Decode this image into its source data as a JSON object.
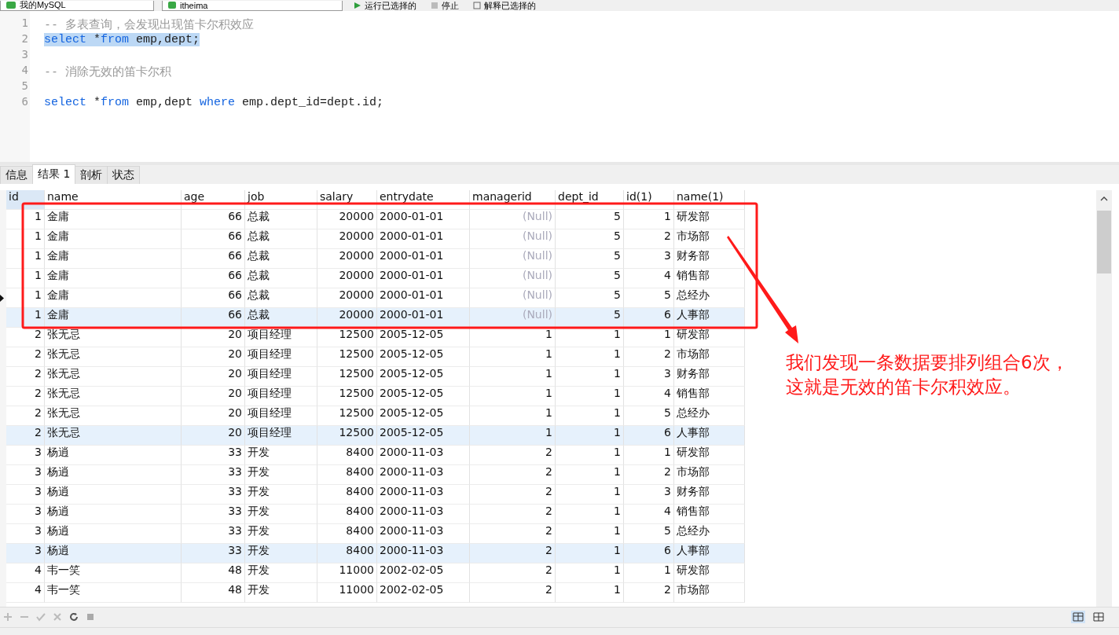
{
  "toolbar": {
    "items": [
      {
        "kind": "connection",
        "label": "我的MySQL"
      },
      {
        "kind": "database",
        "label": "itheima"
      },
      {
        "kind": "run",
        "label": "运行已选择的"
      },
      {
        "kind": "stop",
        "label": "停止"
      },
      {
        "kind": "explain",
        "label": "解释已选择的"
      }
    ]
  },
  "editor": {
    "lines": [
      {
        "number": "1",
        "selected": false,
        "tokens": [
          {
            "kind": "comment",
            "text": "-- 多表查询，会发现出现笛卡尔积效应"
          }
        ]
      },
      {
        "number": "2",
        "selected": true,
        "tokens": [
          {
            "kind": "keyword",
            "text": "select"
          },
          {
            "kind": "plain",
            "text": " *"
          },
          {
            "kind": "keyword",
            "text": "from"
          },
          {
            "kind": "plain",
            "text": " emp,dept;"
          }
        ]
      },
      {
        "number": "3",
        "selected": false
      },
      {
        "number": "4",
        "selected": false,
        "tokens": [
          {
            "kind": "comment",
            "text": "-- 消除无效的笛卡尔积"
          }
        ]
      },
      {
        "number": "5",
        "selected": false
      },
      {
        "number": "6",
        "selected": false,
        "tokens": [
          {
            "kind": "keyword",
            "text": "select"
          },
          {
            "kind": "plain",
            "text": " *"
          },
          {
            "kind": "keyword",
            "text": "from"
          },
          {
            "kind": "plain",
            "text": " emp,dept "
          },
          {
            "kind": "keyword",
            "text": "where"
          },
          {
            "kind": "plain",
            "text": " emp.dept_id=dept.id;"
          }
        ]
      }
    ]
  },
  "tabs": [
    {
      "label": "信息",
      "selected": false
    },
    {
      "label": "结果 1",
      "selected": true
    },
    {
      "label": "剖析",
      "selected": false
    },
    {
      "label": "状态",
      "selected": false
    }
  ],
  "table": {
    "columns": [
      "id",
      "name",
      "age",
      "job",
      "salary",
      "entrydate",
      "managerid",
      "dept_id",
      "id(1)",
      "name(1)"
    ],
    "rows": [
      {
        "cells": [
          "1",
          "金庸",
          "66",
          "总裁",
          "20000",
          "2000-01-01",
          "(Null)",
          "5",
          "1",
          "研发部"
        ],
        "managerid_null": true,
        "selected": false,
        "current": false
      },
      {
        "cells": [
          "1",
          "金庸",
          "66",
          "总裁",
          "20000",
          "2000-01-01",
          "(Null)",
          "5",
          "2",
          "市场部"
        ],
        "managerid_null": true,
        "selected": false,
        "current": false
      },
      {
        "cells": [
          "1",
          "金庸",
          "66",
          "总裁",
          "20000",
          "2000-01-01",
          "(Null)",
          "5",
          "3",
          "财务部"
        ],
        "managerid_null": true,
        "selected": false,
        "current": false
      },
      {
        "cells": [
          "1",
          "金庸",
          "66",
          "总裁",
          "20000",
          "2000-01-01",
          "(Null)",
          "5",
          "4",
          "销售部"
        ],
        "managerid_null": true,
        "selected": false,
        "current": false
      },
      {
        "cells": [
          "1",
          "金庸",
          "66",
          "总裁",
          "20000",
          "2000-01-01",
          "(Null)",
          "5",
          "5",
          "总经办"
        ],
        "managerid_null": true,
        "selected": false,
        "current": true
      },
      {
        "cells": [
          "1",
          "金庸",
          "66",
          "总裁",
          "20000",
          "2000-01-01",
          "(Null)",
          "5",
          "6",
          "人事部"
        ],
        "managerid_null": true,
        "selected": true,
        "current": false
      },
      {
        "cells": [
          "2",
          "张无忌",
          "20",
          "项目经理",
          "12500",
          "2005-12-05",
          "1",
          "1",
          "1",
          "研发部"
        ],
        "managerid_null": false,
        "selected": false,
        "current": false
      },
      {
        "cells": [
          "2",
          "张无忌",
          "20",
          "项目经理",
          "12500",
          "2005-12-05",
          "1",
          "1",
          "2",
          "市场部"
        ],
        "managerid_null": false,
        "selected": false,
        "current": false
      },
      {
        "cells": [
          "2",
          "张无忌",
          "20",
          "项目经理",
          "12500",
          "2005-12-05",
          "1",
          "1",
          "3",
          "财务部"
        ],
        "managerid_null": false,
        "selected": false,
        "current": false
      },
      {
        "cells": [
          "2",
          "张无忌",
          "20",
          "项目经理",
          "12500",
          "2005-12-05",
          "1",
          "1",
          "4",
          "销售部"
        ],
        "managerid_null": false,
        "selected": false,
        "current": false
      },
      {
        "cells": [
          "2",
          "张无忌",
          "20",
          "项目经理",
          "12500",
          "2005-12-05",
          "1",
          "1",
          "5",
          "总经办"
        ],
        "managerid_null": false,
        "selected": false,
        "current": false
      },
      {
        "cells": [
          "2",
          "张无忌",
          "20",
          "项目经理",
          "12500",
          "2005-12-05",
          "1",
          "1",
          "6",
          "人事部"
        ],
        "managerid_null": false,
        "selected": true,
        "current": false
      },
      {
        "cells": [
          "3",
          "杨逍",
          "33",
          "开发",
          "8400",
          "2000-11-03",
          "2",
          "1",
          "1",
          "研发部"
        ],
        "managerid_null": false,
        "selected": false,
        "current": false
      },
      {
        "cells": [
          "3",
          "杨逍",
          "33",
          "开发",
          "8400",
          "2000-11-03",
          "2",
          "1",
          "2",
          "市场部"
        ],
        "managerid_null": false,
        "selected": false,
        "current": false
      },
      {
        "cells": [
          "3",
          "杨逍",
          "33",
          "开发",
          "8400",
          "2000-11-03",
          "2",
          "1",
          "3",
          "财务部"
        ],
        "managerid_null": false,
        "selected": false,
        "current": false
      },
      {
        "cells": [
          "3",
          "杨逍",
          "33",
          "开发",
          "8400",
          "2000-11-03",
          "2",
          "1",
          "4",
          "销售部"
        ],
        "managerid_null": false,
        "selected": false,
        "current": false
      },
      {
        "cells": [
          "3",
          "杨逍",
          "33",
          "开发",
          "8400",
          "2000-11-03",
          "2",
          "1",
          "5",
          "总经办"
        ],
        "managerid_null": false,
        "selected": false,
        "current": false
      },
      {
        "cells": [
          "3",
          "杨逍",
          "33",
          "开发",
          "8400",
          "2000-11-03",
          "2",
          "1",
          "6",
          "人事部"
        ],
        "managerid_null": false,
        "selected": true,
        "current": false
      },
      {
        "cells": [
          "4",
          "韦一笑",
          "48",
          "开发",
          "11000",
          "2002-02-05",
          "2",
          "1",
          "1",
          "研发部"
        ],
        "managerid_null": false,
        "selected": false,
        "current": false
      },
      {
        "cells": [
          "4",
          "韦一笑",
          "48",
          "开发",
          "11000",
          "2002-02-05",
          "2",
          "1",
          "2",
          "市场部"
        ],
        "managerid_null": false,
        "selected": false,
        "current": false
      }
    ]
  },
  "annotation": {
    "text": "我们发现一条数据要排列组合6次，这就是无效的笛卡尔积效应。"
  }
}
